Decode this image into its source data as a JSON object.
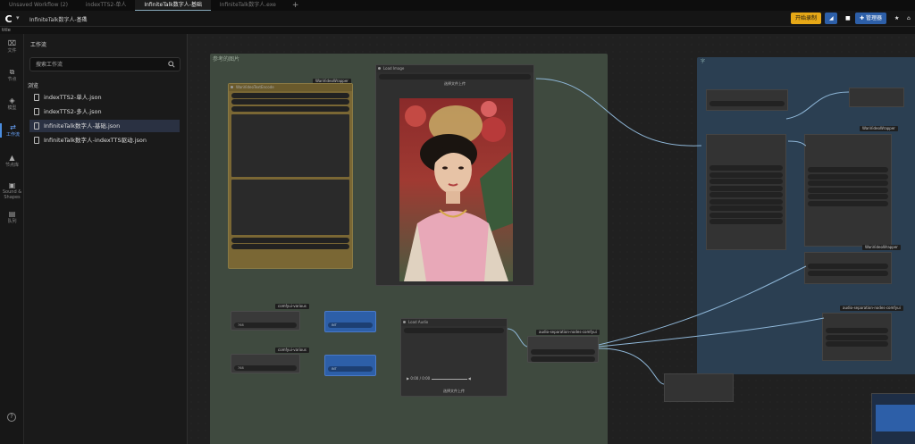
{
  "tabs": [
    {
      "label": "Unsaved Workflow (2)"
    },
    {
      "label": "indexTTS2-单人"
    },
    {
      "label": "InfiniteTalk数字人-基础"
    },
    {
      "label": "InfiniteTalk数字人.exe"
    }
  ],
  "tab_add": "+",
  "titlebar": {
    "logo": "C",
    "workflow_title": "InfiniteTalk数字人-基础",
    "vip_button": "开始录制",
    "manage_button": "管理器"
  },
  "subbar_text": "title",
  "rail": [
    {
      "icon": "folder-icon",
      "glyph": "⌧",
      "label": "文件"
    },
    {
      "icon": "node-icon",
      "glyph": "⧉",
      "label": "节点"
    },
    {
      "icon": "model-icon",
      "glyph": "◈",
      "label": "模型"
    },
    {
      "icon": "workflow-icon",
      "glyph": "⇄",
      "label": "工作流"
    },
    {
      "icon": "template-icon",
      "glyph": "▲",
      "label": "节点库"
    },
    {
      "icon": "image-icon",
      "glyph": "▣",
      "label": "Sound & Shapes"
    },
    {
      "icon": "queue-icon",
      "glyph": "▤",
      "label": "队列"
    }
  ],
  "help": "?",
  "sidebar": {
    "title": "工作流",
    "search_placeholder": "搜索工作流",
    "section": "浏览",
    "files": [
      {
        "name": "indexTTS2-单人.json",
        "selected": false
      },
      {
        "name": "indexTTS2-多人.json",
        "selected": false
      },
      {
        "name": "InfiniteTalk数字人-基础.json",
        "selected": true
      },
      {
        "name": "InfiniteTalk数字人-indexTTS驱动.json",
        "selected": false
      }
    ]
  },
  "canvas": {
    "group_main_title": "参考的图片",
    "group_right_title": "字",
    "image_node_label": "Load Image",
    "audio_node_label": "Load Audio",
    "audio_time": "0:00 / 0:00",
    "audio_button": "选择文件上传",
    "image_button": "选择文件上传",
    "prompt_node_title": "WanVideoTextEncode",
    "node_labels": [
      "comfyui-various",
      "comfyui-various",
      "audio-separation-nodes-comfyui",
      "audio-separation-nodes-comfyui",
      "WanVideoWrapper",
      "WanVideoWrapper",
      "WanVideoWrapper",
      "WanVideoWrapper"
    ],
    "int_labels": [
      "INT",
      "INT"
    ],
    "int_values": [
      "768",
      "768"
    ]
  }
}
